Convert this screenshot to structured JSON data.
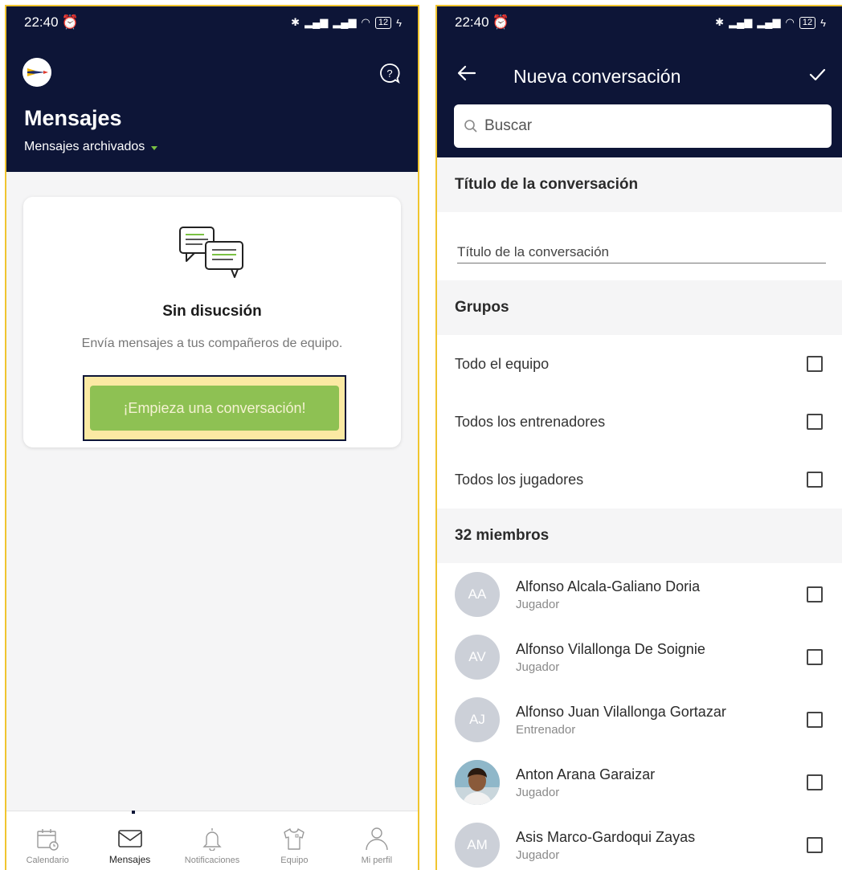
{
  "status": {
    "time": "22:40",
    "battery": "12"
  },
  "left": {
    "title": "Mensajes",
    "subtitle": "Mensajes archivados",
    "card": {
      "title": "Sin disucsión",
      "subtitle": "Envía mensajes a tus compañeros de equipo.",
      "cta": "¡Empieza una conversación!"
    },
    "nav": [
      {
        "label": "Calendario",
        "icon": "calendar-icon"
      },
      {
        "label": "Mensajes",
        "icon": "mail-icon"
      },
      {
        "label": "Notificaciones",
        "icon": "bell-icon"
      },
      {
        "label": "Equipo",
        "icon": "shirt-icon"
      },
      {
        "label": "Mi perfil",
        "icon": "person-icon"
      }
    ]
  },
  "right": {
    "title": "Nueva conversación",
    "search_placeholder": "Buscar",
    "title_section": "Título de la conversación",
    "title_placeholder": "Título de la conversación",
    "groups_section": "Grupos",
    "groups": [
      "Todo el equipo",
      "Todos los entrenadores",
      "Todos los jugadores"
    ],
    "members_section": "32 miembros",
    "members": [
      {
        "initials": "AA",
        "name": "Alfonso Alcala-Galiano Doria",
        "role": "Jugador"
      },
      {
        "initials": "AV",
        "name": "Alfonso Vilallonga De Soignie",
        "role": "Jugador"
      },
      {
        "initials": "AJ",
        "name": "Alfonso Juan Vilallonga Gortazar",
        "role": "Entrenador"
      },
      {
        "initials": "",
        "name": "Anton Arana Garaizar",
        "role": "Jugador"
      },
      {
        "initials": "AM",
        "name": "Asis Marco-Gardoqui Zayas",
        "role": "Jugador"
      }
    ]
  },
  "colors": {
    "navy": "#0d1537",
    "green": "#8ec153",
    "highlight": "#fbe08e",
    "frame": "#f0c52f"
  }
}
